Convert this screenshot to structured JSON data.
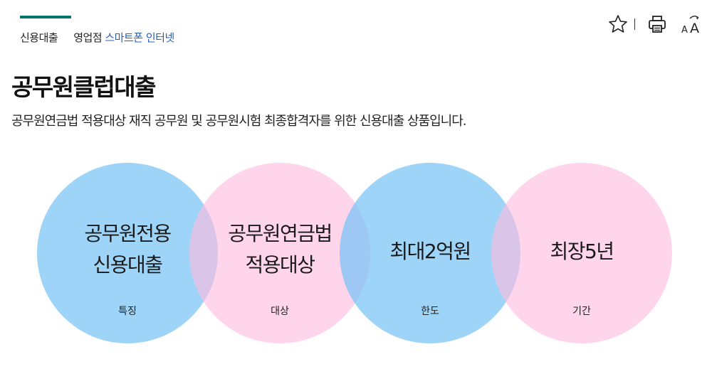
{
  "tabs": {
    "first": "신용대출",
    "second_prefix": "영업점 ",
    "second_highlight": "스마트폰 인터넷"
  },
  "tools": {
    "favorite_icon": "star-outline-icon",
    "print_icon": "printer-icon",
    "font_size_icon": "text-size-icon",
    "font_size_label": "AA"
  },
  "title": "공무원클럽대출",
  "description": "공무원연금법 적용대상 재직 공무원 및 공무원시험 최종합격자를 위한 신용대출 상품입니다.",
  "features": [
    {
      "line1": "공무원전용",
      "line2": "신용대출",
      "label": "특징",
      "color": "#77c4f5"
    },
    {
      "line1": "공무원연금법",
      "line2": "적용대상",
      "label": "대상",
      "color": "#ffbce0"
    },
    {
      "line1": "최대2억원",
      "line2": "",
      "label": "한도",
      "color": "#77c4f5"
    },
    {
      "line1": "최장5년",
      "line2": "",
      "label": "기간",
      "color": "#ffbce0"
    }
  ],
  "colors": {
    "accent": "#00756a",
    "link": "#2a5fb0"
  }
}
